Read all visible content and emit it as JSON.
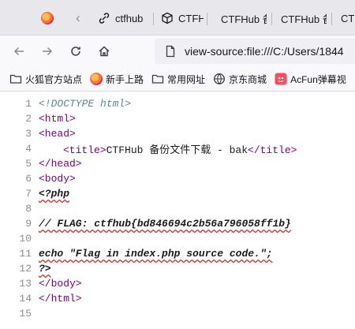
{
  "tabs": [
    {
      "label": "ctfhub"
    },
    {
      "label": "CTFHub"
    },
    {
      "label": "CTFHub 备"
    },
    {
      "label": "CTFHub 备"
    },
    {
      "label": "CTFH"
    }
  ],
  "nav": {
    "url": "view-source:file:///C:/Users/1844"
  },
  "bookmarks": [
    {
      "label": "火狐官方站点",
      "icon": "folder-icon"
    },
    {
      "label": "新手上路",
      "icon": "firefox-icon"
    },
    {
      "label": "常用网址",
      "icon": "folder-icon"
    },
    {
      "label": "京东商城",
      "icon": "globe-icon"
    },
    {
      "label": "AcFun弹幕视",
      "icon": "acfun-icon"
    }
  ],
  "source": {
    "line_numbers": [
      "1",
      "2",
      "3",
      "4",
      "5",
      "6",
      "7",
      "8",
      "9",
      "10",
      "11",
      "12",
      "13",
      "14",
      "15"
    ],
    "l1": "<!DOCTYPE html>",
    "l2": "<html>",
    "l3": "<head>",
    "l4_open": "<title>",
    "l4_text": "CTFHub 备份文件下载 - bak",
    "l4_close": "</title>",
    "l5": "</head>",
    "l6": "<body>",
    "l7": "<?php",
    "l9": "// FLAG: ctfhub{bd846694c2b56a796058ff1b}",
    "l11": "echo \"Flag in index.php source code.\";",
    "l12": "?>",
    "l13": "</body>",
    "l14": "</html>"
  }
}
